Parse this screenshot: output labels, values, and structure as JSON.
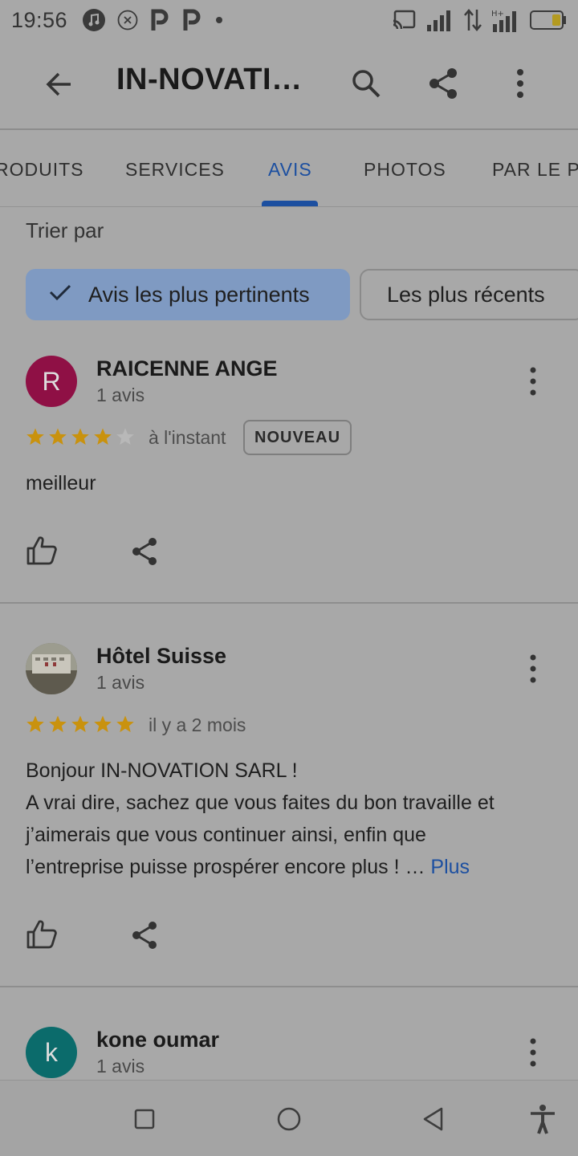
{
  "status_bar": {
    "time": "19:56",
    "left_icons": [
      "music-icon",
      "close-circle-icon",
      "p-icon",
      "p-icon",
      "dot-icon"
    ],
    "right_icons": [
      "cast-icon",
      "signal-icon",
      "data-arrows-icon",
      "hplus-signal-icon",
      "battery-icon"
    ],
    "battery_level": 0.2
  },
  "app_bar": {
    "title": "IN-NOVATI…",
    "icons": [
      "back-arrow-icon",
      "search-icon",
      "share-icon",
      "more-vert-icon"
    ]
  },
  "tabs": [
    {
      "label": "RODUITS",
      "active": false
    },
    {
      "label": "SERVICES",
      "active": false
    },
    {
      "label": "AVIS",
      "active": true
    },
    {
      "label": "PHOTOS",
      "active": false
    },
    {
      "label": "PAR LE PI",
      "active": false
    }
  ],
  "sort": {
    "label": "Trier par",
    "options": [
      {
        "label": "Avis les plus pertinents",
        "selected": true
      },
      {
        "label": "Les plus récents",
        "selected": false
      }
    ]
  },
  "reviews": [
    {
      "avatar_letter": "R",
      "avatar_color": "#8f1045",
      "name": "RAICENNE ANGE",
      "count": "1 avis",
      "rating": 4,
      "time": "à l'instant",
      "badge": "NOUVEAU",
      "text": "meilleur"
    },
    {
      "avatar_letter": "",
      "avatar_color": "#6b6b5e",
      "name": "Hôtel Suisse",
      "count": "1 avis",
      "rating": 5,
      "time": "il y a 2 mois",
      "badge": "",
      "text_lines": [
        "Bonjour IN-NOVATION SARL !",
        "A vrai dire, sachez que vous faites du bon travaille et",
        "j’aimerais que vous continuer ainsi, enfin que",
        "l’entreprise puisse prospérer encore plus ! …"
      ],
      "more_link": "Plus"
    },
    {
      "avatar_letter": "k",
      "avatar_color": "#0b6b6b",
      "name": "kone oumar",
      "count": "1 avis"
    }
  ],
  "colors": {
    "accent": "#1c4fa0",
    "star": "#c9920e",
    "star_empty": "#b8b8b8"
  },
  "nav_bar": {
    "icons": [
      "recents-square-icon",
      "home-circle-icon",
      "back-triangle-icon",
      "accessibility-icon"
    ]
  }
}
